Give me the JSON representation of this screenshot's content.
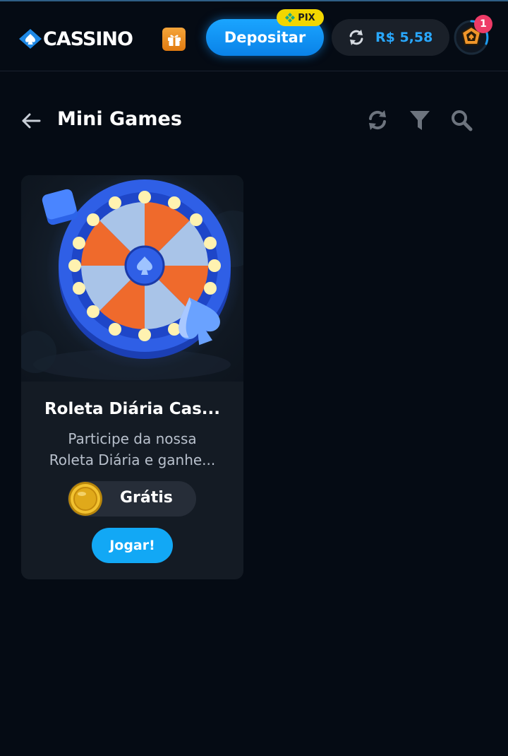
{
  "header": {
    "logo_text": "CASSINO",
    "deposit_label": "Depositar",
    "pix_badge": "PIX",
    "balance": "R$ 5,58",
    "notification_count": "1"
  },
  "page": {
    "title": "Mini Games"
  },
  "card": {
    "title": "Roleta Diária Cas...",
    "description_line1": "Participe da nossa",
    "description_line2": "Roleta Diária e ganhe...",
    "price": "Grátis",
    "play_label": "Jogar!"
  },
  "icons": {
    "logo": "spade-diamond-icon",
    "gift": "gift-icon",
    "pix": "pix-icon",
    "refresh": "refresh-icon",
    "avatar": "shield-avatar-icon",
    "back": "arrow-left-icon",
    "filter": "filter-icon",
    "search": "search-icon",
    "coin": "coin-icon"
  },
  "colors": {
    "background": "#050b14",
    "accent": "#12a8f5",
    "balance": "#29a8ff",
    "pix_badge": "#f2d600",
    "notification": "#ee3b67",
    "card": "#141b24"
  }
}
